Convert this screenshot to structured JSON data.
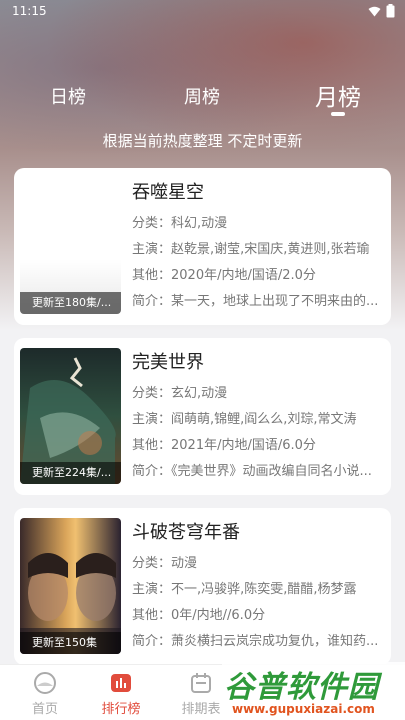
{
  "status": {
    "time": "11:15"
  },
  "tabs": [
    {
      "label": "日榜"
    },
    {
      "label": "周榜"
    },
    {
      "label": "月榜"
    }
  ],
  "subtitle": "根据当前热度整理 不定时更新",
  "items": [
    {
      "title": "吞噬星空",
      "poster_label": "更新至180集/...",
      "category": "分类：科幻,动漫",
      "cast": "主演：赵乾景,谢莹,宋国庆,黄进则,张若瑜",
      "other": "其他：2020年/内地/国语/2.0分",
      "intro": "简介：某一天，地球上出现了不明来由的..."
    },
    {
      "title": "完美世界",
      "poster_label": "更新至224集/...",
      "category": "分类：玄幻,动漫",
      "cast": "主演：阎萌萌,锦鲤,阎么么,刘琮,常文涛",
      "other": "其他：2021年/内地/国语/6.0分",
      "intro": "简介：《完美世界》动画改编自同名小说..."
    },
    {
      "title": "斗破苍穹年番",
      "poster_label": "更新至150集",
      "category": "分类：动漫",
      "cast": "主演：不一,冯骏骅,陈奕雯,醋醋,杨梦露",
      "other": "其他：0年/内地//6.0分",
      "intro": "简介：萧炎横扫云岚宗成功复仇，谁知药..."
    }
  ],
  "nav": [
    {
      "label": "首页",
      "icon": "home-icon"
    },
    {
      "label": "排行榜",
      "icon": "chart-icon"
    },
    {
      "label": "排期表",
      "icon": "calendar-icon"
    }
  ],
  "watermark": {
    "big": "谷普软件园",
    "small": "www.gupuxiazai.com"
  },
  "colors": {
    "accent": "#e14c3c",
    "watermark_green": "#2f9a3a"
  }
}
